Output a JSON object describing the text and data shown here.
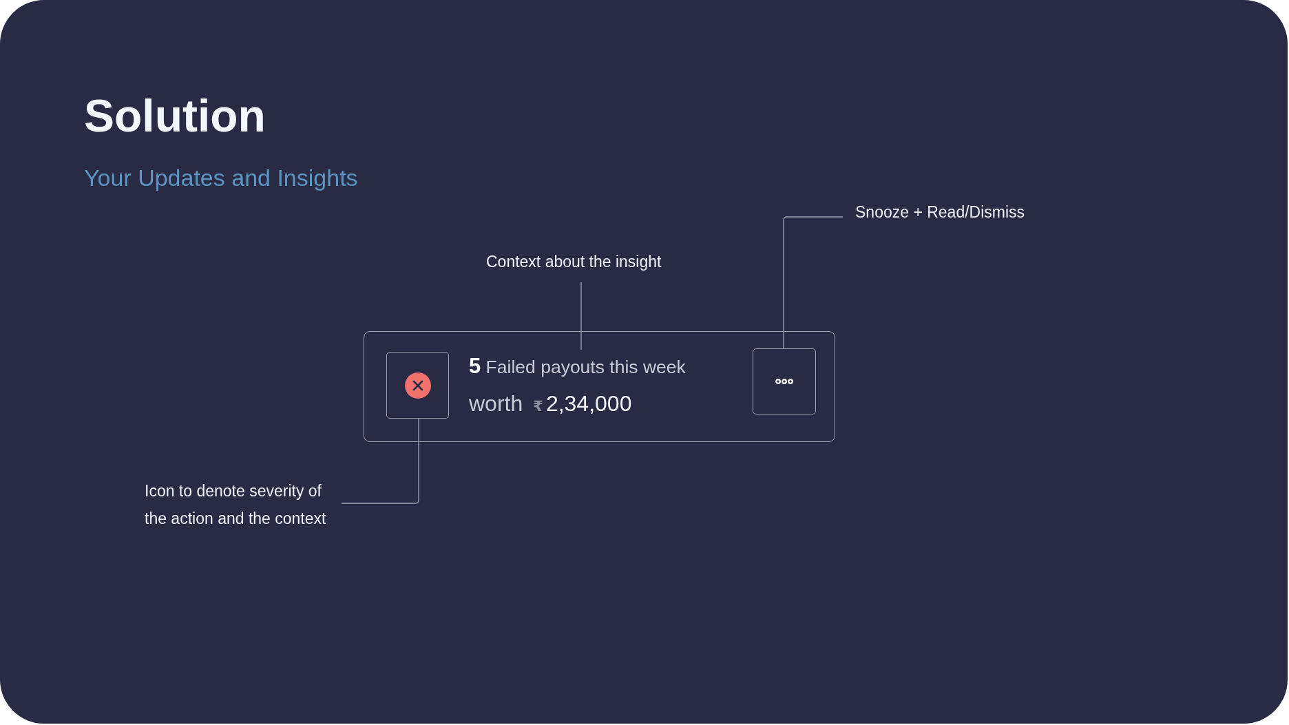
{
  "slide": {
    "title": "Solution",
    "subtitle": "Your Updates and Insights"
  },
  "annotations": {
    "menu": "Snooze + Read/Dismiss",
    "headline": "Context about the insight",
    "icon": "Icon to denote severity of the action and the context"
  },
  "insight_card": {
    "kind": "error",
    "headline": "**5** Failed payouts this week",
    "amount_label": "worth",
    "currency": "₹",
    "amount": "2,34,000"
  }
}
